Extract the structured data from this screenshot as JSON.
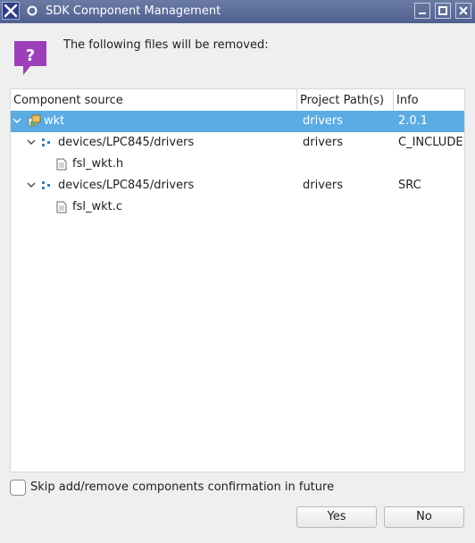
{
  "window": {
    "title": "SDK Component Management",
    "controls": [
      "minimize-icon",
      "maximize-icon",
      "close-icon"
    ]
  },
  "dialog": {
    "icon": "help-question-icon",
    "message": "The following files will be removed:"
  },
  "table": {
    "columns": [
      "Component source",
      "Project Path(s)",
      "Info"
    ],
    "rows": [
      {
        "label": "wkt",
        "path": "drivers",
        "info": "2.0.1",
        "icon": "component-package-icon",
        "selected": true
      },
      {
        "label": "devices/LPC845/drivers",
        "path": "drivers",
        "info": "C_INCLUDE",
        "icon": "folder-node-icon"
      },
      {
        "label": "fsl_wkt.h",
        "path": "",
        "info": "",
        "icon": "file-icon"
      },
      {
        "label": "devices/LPC845/drivers",
        "path": "drivers",
        "info": "SRC",
        "icon": "folder-node-icon"
      },
      {
        "label": "fsl_wkt.c",
        "path": "",
        "info": "",
        "icon": "file-icon"
      }
    ]
  },
  "options": {
    "skip_label": "Skip add/remove components confirmation in future",
    "skip_checked": false
  },
  "buttons": {
    "yes": "Yes",
    "no": "No"
  },
  "colors": {
    "titlebar": "#5a6b98",
    "selection": "#5aace3",
    "help_icon": "#9c3fb8"
  }
}
